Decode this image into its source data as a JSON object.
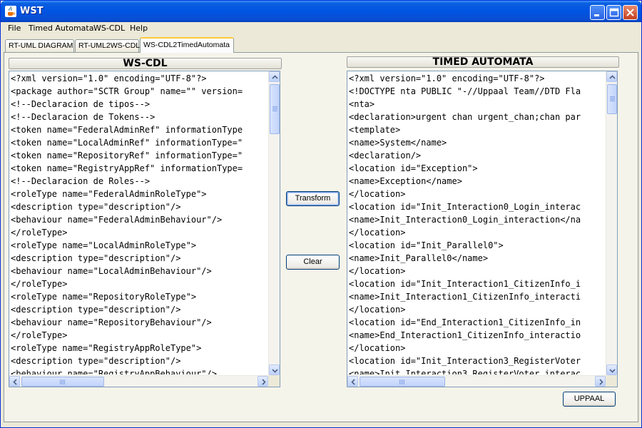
{
  "window": {
    "title": "WST"
  },
  "menu": {
    "items": [
      "File",
      "Timed Automata",
      "WS-CDL",
      "Help"
    ]
  },
  "tabs": [
    {
      "label": "RT-UML DIAGRAM"
    },
    {
      "label": "RT-UML2WS-CDL"
    },
    {
      "label": "WS-CDL2TimedAutomata",
      "active": true
    }
  ],
  "left_panel": {
    "title": "WS-CDL",
    "lines": [
      "<?xml version=\"1.0\" encoding=\"UTF-8\"?>",
      "<package author=\"SCTR Group\" name=\"\" version=",
      "<!--Declaracion de tipos-->",
      "<!--Declaracion de Tokens-->",
      "<token name=\"FederalAdminRef\" informationType",
      "<token name=\"LocalAdminRef\" informationType=\"",
      "<token name=\"RepositoryRef\" informationType=\"",
      "<token name=\"RegistryAppRef\" informationType=",
      "<!--Declaracion de Roles-->",
      "<roleType name=\"FederalAdminRoleType\">",
      "<description type=\"description\"/>",
      "<behaviour name=\"FederalAdminBehaviour\"/>",
      "</roleType>",
      "<roleType name=\"LocalAdminRoleType\">",
      "<description type=\"description\"/>",
      "<behaviour name=\"LocalAdminBehaviour\"/>",
      "</roleType>",
      "<roleType name=\"RepositoryRoleType\">",
      "<description type=\"description\"/>",
      "<behaviour name=\"RepositoryBehaviour\"/>",
      "</roleType>",
      "<roleType name=\"RegistryAppRoleType\">",
      "<description type=\"description\"/>",
      "<behaviour name=\"RegistryAppBehaviour\"/>"
    ]
  },
  "right_panel": {
    "title": "TIMED AUTOMATA",
    "lines": [
      "<?xml version=\"1.0\" encoding=\"UTF-8\"?>",
      "<!DOCTYPE nta PUBLIC \"-//Uppaal Team//DTD Fla",
      "<nta>",
      "<declaration>urgent chan urgent_chan;chan par",
      "<template>",
      "<name>System</name>",
      "<declaration/>",
      "<location id=\"Exception\">",
      "<name>Exception</name>",
      "</location>",
      "<location id=\"Init_Interaction0_Login_interac",
      "<name>Init_Interaction0_Login_interaction</na",
      "</location>",
      "<location id=\"Init_Parallel0\">",
      "<name>Init_Parallel0</name>",
      "</location>",
      "<location id=\"Init_Interaction1_CitizenInfo_i",
      "<name>Init_Interaction1_CitizenInfo_interacti",
      "</location>",
      "<location id=\"End_Interaction1_CitizenInfo_in",
      "<name>End_Interaction1_CitizenInfo_interactio",
      "</location>",
      "<location id=\"Init_Interaction3_RegisterVoter",
      "<name>Init_Interaction3_RegisterVoter_interac"
    ]
  },
  "buttons": {
    "transform": "Transform",
    "clear": "Clear",
    "uppaal": "UPPAAL"
  }
}
